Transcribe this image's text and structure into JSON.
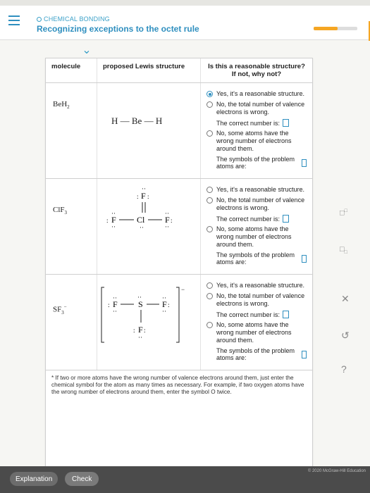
{
  "header": {
    "subject": "CHEMICAL BONDING",
    "title": "Recognizing exceptions to the octet rule",
    "progress_fraction": 0.55
  },
  "table": {
    "col_molecule": "molecule",
    "col_lewis": "proposed Lewis structure",
    "col_question_1": "Is this a reasonable structure?",
    "col_question_2": "If not, why not?",
    "rows": [
      {
        "molecule_base": "BeH",
        "molecule_sub": "2",
        "lewis_text": "H — Be — H",
        "options": {
          "yes": "Yes, it's a reasonable structure.",
          "no_total": "No, the total number of valence electrons is wrong.",
          "correct_number": "The correct number is:",
          "no_wrong_atoms": "No, some atoms have the wrong number of electrons around them.",
          "symbols": "The symbols of the problem atoms are:"
        },
        "selected": "yes"
      },
      {
        "molecule_base": "ClF",
        "molecule_sub": "3",
        "options": {
          "yes": "Yes, it's a reasonable structure.",
          "no_total": "No, the total number of valence electrons is wrong.",
          "correct_number": "The correct number is:",
          "no_wrong_atoms": "No, some atoms have the wrong number of electrons around them.",
          "symbols": "The symbols of the problem atoms are:"
        },
        "selected": ""
      },
      {
        "molecule_base": "SF",
        "molecule_sub": "3",
        "charge": "−",
        "options": {
          "yes": "Yes, it's a reasonable structure.",
          "no_total": "No, the total number of valence electrons is wrong.",
          "correct_number": "The correct number is:",
          "no_wrong_atoms": "No, some atoms have the wrong number of electrons around them.",
          "symbols": "The symbols of the problem atoms are:"
        },
        "selected": ""
      }
    ],
    "footnote": "* If two or more atoms have the wrong number of valence electrons around them, just enter the chemical symbol for the atom as many times as necessary. For example, if two oxygen atoms have the wrong number of electrons around them, enter the symbol O twice."
  },
  "footer": {
    "explanation_label": "Explanation",
    "check_label": "Check",
    "copyright": "© 2020 McGraw-Hill Education"
  },
  "colors": {
    "accent": "#2f8fbf",
    "progress": "#f5a623",
    "footer": "#4b4b4b"
  }
}
